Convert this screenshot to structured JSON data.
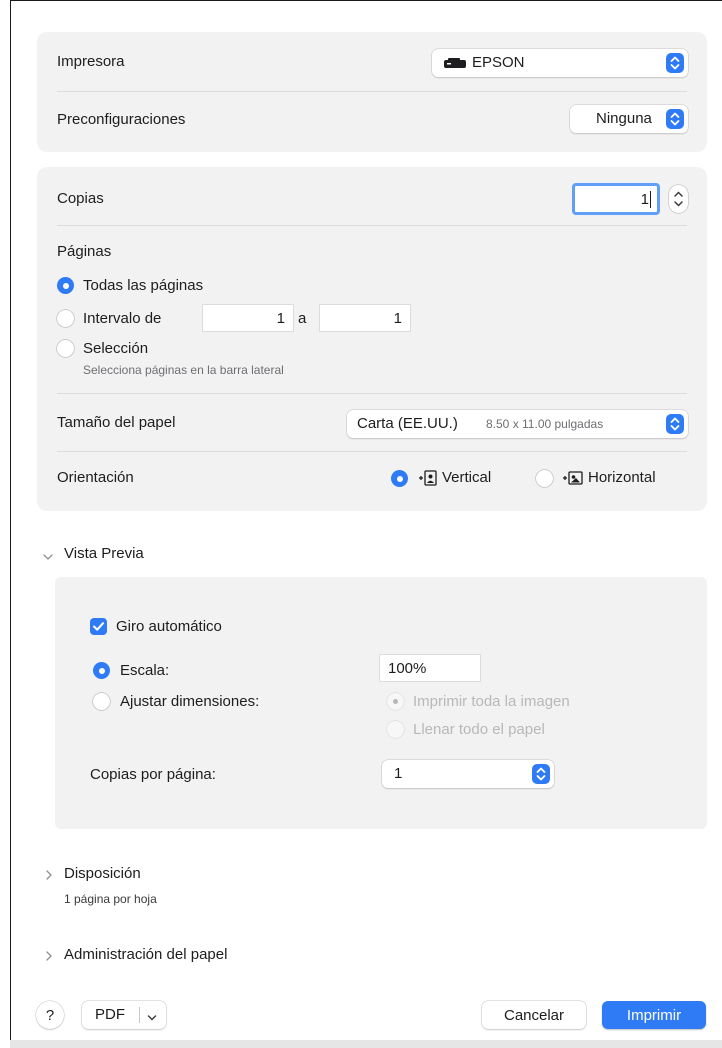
{
  "printer": {
    "label": "Impresora",
    "value": "EPSON"
  },
  "presets": {
    "label": "Preconfiguraciones",
    "value": "Ninguna"
  },
  "copies": {
    "label": "Copias",
    "value": "1"
  },
  "pages": {
    "label": "Páginas",
    "all": "Todas las páginas",
    "range": "Intervalo de",
    "range_from": "1",
    "range_sep": "a",
    "range_to": "1",
    "selection": "Selección",
    "selection_hint": "Selecciona páginas en la barra lateral",
    "selected": "all"
  },
  "paper_size": {
    "label": "Tamaño del papel",
    "value": "Carta (EE.UU.)",
    "dimensions": "8.50 x 11.00 pulgadas"
  },
  "orientation": {
    "label": "Orientación",
    "vertical": "Vertical",
    "horizontal": "Horizontal",
    "selected": "vertical"
  },
  "preview": {
    "title": "Vista Previa",
    "auto_rotate": "Giro automático",
    "auto_rotate_checked": true,
    "scale_label": "Escala:",
    "scale_value": "100%",
    "fit_label": "Ajustar dimensiones:",
    "print_entire": "Imprimir toda la imagen",
    "fill_paper": "Llenar todo el papel",
    "copies_per_page_label": "Copias por página:",
    "copies_per_page_value": "1"
  },
  "layout": {
    "title": "Disposición",
    "summary": "1 página por hoja"
  },
  "paper_handling": {
    "title": "Administración del papel"
  },
  "footer": {
    "help": "?",
    "pdf": "PDF",
    "cancel": "Cancelar",
    "print": "Imprimir"
  },
  "colors": {
    "accent": "#2f7bf6",
    "panel": "#f2f2f2"
  }
}
